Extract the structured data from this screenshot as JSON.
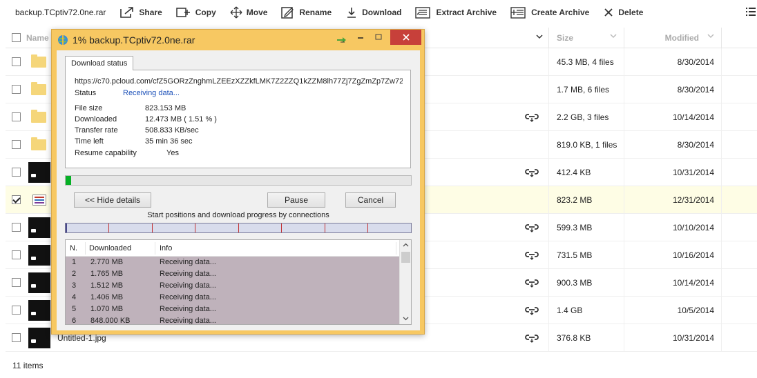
{
  "toolbar": {
    "filename": "backup.TCptiv72.0ne.rar",
    "share": "Share",
    "copy": "Copy",
    "move": "Move",
    "rename": "Rename",
    "download": "Download",
    "extract": "Extract Archive",
    "create_archive": "Create Archive",
    "delete": "Delete"
  },
  "table": {
    "header_name": "Name",
    "header_size": "Size",
    "header_modified": "Modified",
    "rows": [
      {
        "type": "folder",
        "name": "",
        "size": "45.3 MB, 4 files",
        "modified": "8/30/2014",
        "shared": false,
        "checked": false
      },
      {
        "type": "folder",
        "name": "",
        "size": "1.7 MB, 6 files",
        "modified": "8/30/2014",
        "shared": false,
        "checked": false
      },
      {
        "type": "folder",
        "name": "",
        "size": "2.2 GB, 3 files",
        "modified": "10/14/2014",
        "shared": true,
        "checked": false
      },
      {
        "type": "folder",
        "name": "",
        "size": "819.0 KB, 1 files",
        "modified": "8/30/2014",
        "shared": false,
        "checked": false
      },
      {
        "type": "image",
        "name": "",
        "size": "412.4 KB",
        "modified": "10/31/2014",
        "shared": true,
        "checked": false
      },
      {
        "type": "archive",
        "name": "",
        "size": "823.2 MB",
        "modified": "12/31/2014",
        "shared": false,
        "checked": true
      },
      {
        "type": "image",
        "name": "",
        "size": "599.3 MB",
        "modified": "10/10/2014",
        "shared": true,
        "checked": false
      },
      {
        "type": "image",
        "name": "",
        "size": "731.5 MB",
        "modified": "10/16/2014",
        "shared": true,
        "checked": false
      },
      {
        "type": "image",
        "name": "",
        "size": "900.3 MB",
        "modified": "10/14/2014",
        "shared": true,
        "checked": false
      },
      {
        "type": "image",
        "name": "",
        "size": "1.4 GB",
        "modified": "10/5/2014",
        "shared": true,
        "checked": false
      },
      {
        "type": "image",
        "name": "Untitled-1.jpg",
        "size": "376.8 KB",
        "modified": "10/31/2014",
        "shared": true,
        "checked": false
      }
    ]
  },
  "footer": {
    "items_count": "11 items"
  },
  "dialog": {
    "title": "1% backup.TCptiv72.0ne.rar",
    "tab_label": "Download status",
    "url": "https://c70.pcloud.com/cfZ5GORzZnghmLZEEzXZZkfLMK7Z2ZZQ1kZZM8lh77Zj7ZgZmZp7Zw72",
    "status_label": "Status",
    "status_value": "Receiving data...",
    "file_size_label": "File size",
    "file_size_value": "823.153  MB",
    "downloaded_label": "Downloaded",
    "downloaded_value": "12.473  MB  ( 1.51 % )",
    "transfer_rate_label": "Transfer rate",
    "transfer_rate_value": "508.833  KB/sec",
    "time_left_label": "Time left",
    "time_left_value": "35 min 36 sec",
    "resume_label": "Resume capability",
    "resume_value": "Yes",
    "progress_percent": 1.51,
    "hide_details": "<< Hide details",
    "pause": "Pause",
    "cancel": "Cancel",
    "connections_label": "Start positions and download progress by connections",
    "conn_header_n": "N.",
    "conn_header_downloaded": "Downloaded",
    "conn_header_info": "Info",
    "connections": [
      {
        "n": "1",
        "downloaded": "2.770  MB",
        "info": "Receiving data..."
      },
      {
        "n": "2",
        "downloaded": "1.765  MB",
        "info": "Receiving data..."
      },
      {
        "n": "3",
        "downloaded": "1.512  MB",
        "info": "Receiving data..."
      },
      {
        "n": "4",
        "downloaded": "1.406  MB",
        "info": "Receiving data..."
      },
      {
        "n": "5",
        "downloaded": "1.070  MB",
        "info": "Receiving data..."
      },
      {
        "n": "6",
        "downloaded": "848.000  KB",
        "info": "Receiving data..."
      }
    ]
  },
  "colors": {
    "dialog_frame": "#f7c862",
    "close_button": "#c7403a",
    "progress_fill": "#06b025",
    "selected_row": "#fefde5",
    "connection_rows": "#bfb2bb"
  }
}
